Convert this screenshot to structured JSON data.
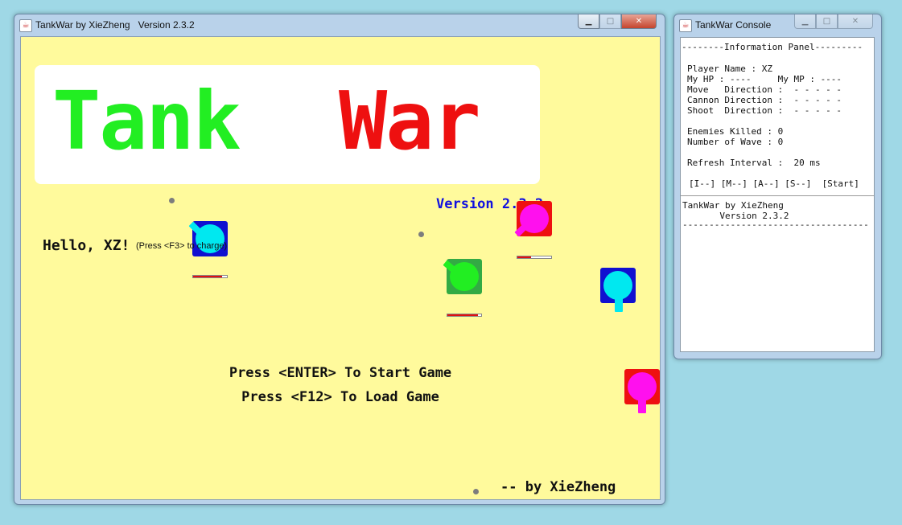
{
  "game_window": {
    "title": "TankWar by XieZheng   Version 2.3.2",
    "logo_word1": "Tank",
    "logo_word2": "War",
    "logo_color1": "#22ee22",
    "logo_color2": "#ee1010",
    "version": "Version 2.3.2",
    "hello": "Hello, XZ!",
    "hello_hint": "(Press <F3> to charge)",
    "start_line": "Press <ENTER> To Start Game",
    "load_line": "Press <F12> To Load Game",
    "credit": "-- by XieZheng"
  },
  "console_window": {
    "title": "TankWar Console",
    "header": "--------Information Panel---------",
    "player_name": "Player Name : XZ",
    "hp_mp": "My HP : ----     My MP : ----",
    "move_dir": "Move   Direction :  - - - - -",
    "cannon_dir": "Cannon Direction :  - - - - -",
    "shoot_dir": "Shoot  Direction :  - - - - -",
    "enemies_killed": "Enemies Killed : 0",
    "wave": "Number of Wave : 0",
    "refresh": "Refresh Interval :  20 ms",
    "buttons": "[I--] [M--] [A--] [S--]  [Start]",
    "log_line1": "TankWar by XieZheng",
    "log_line2": "       Version 2.3.2",
    "log_rule": "-----------------------------------"
  },
  "colors": {
    "canvas_bg": "#fffa9c",
    "desktop_bg": "#9fd8e6",
    "blue_tank": "#1010d0",
    "cyan_turret": "#00e8f0",
    "green_tank": "#33aa44",
    "green_turret": "#22ee22",
    "red_tank": "#ee1010",
    "magenta_turret": "#ff10ee"
  },
  "tanks": [
    {
      "id": "blue-tank-1",
      "hp": 0.85
    },
    {
      "id": "green-tank",
      "hp": 0.9
    },
    {
      "id": "red-tank-1",
      "hp": 0.4
    },
    {
      "id": "blue-tank-2"
    },
    {
      "id": "red-tank-2"
    }
  ],
  "icons": [
    "java-icon",
    "minimize-icon",
    "maximize-icon",
    "close-icon"
  ]
}
